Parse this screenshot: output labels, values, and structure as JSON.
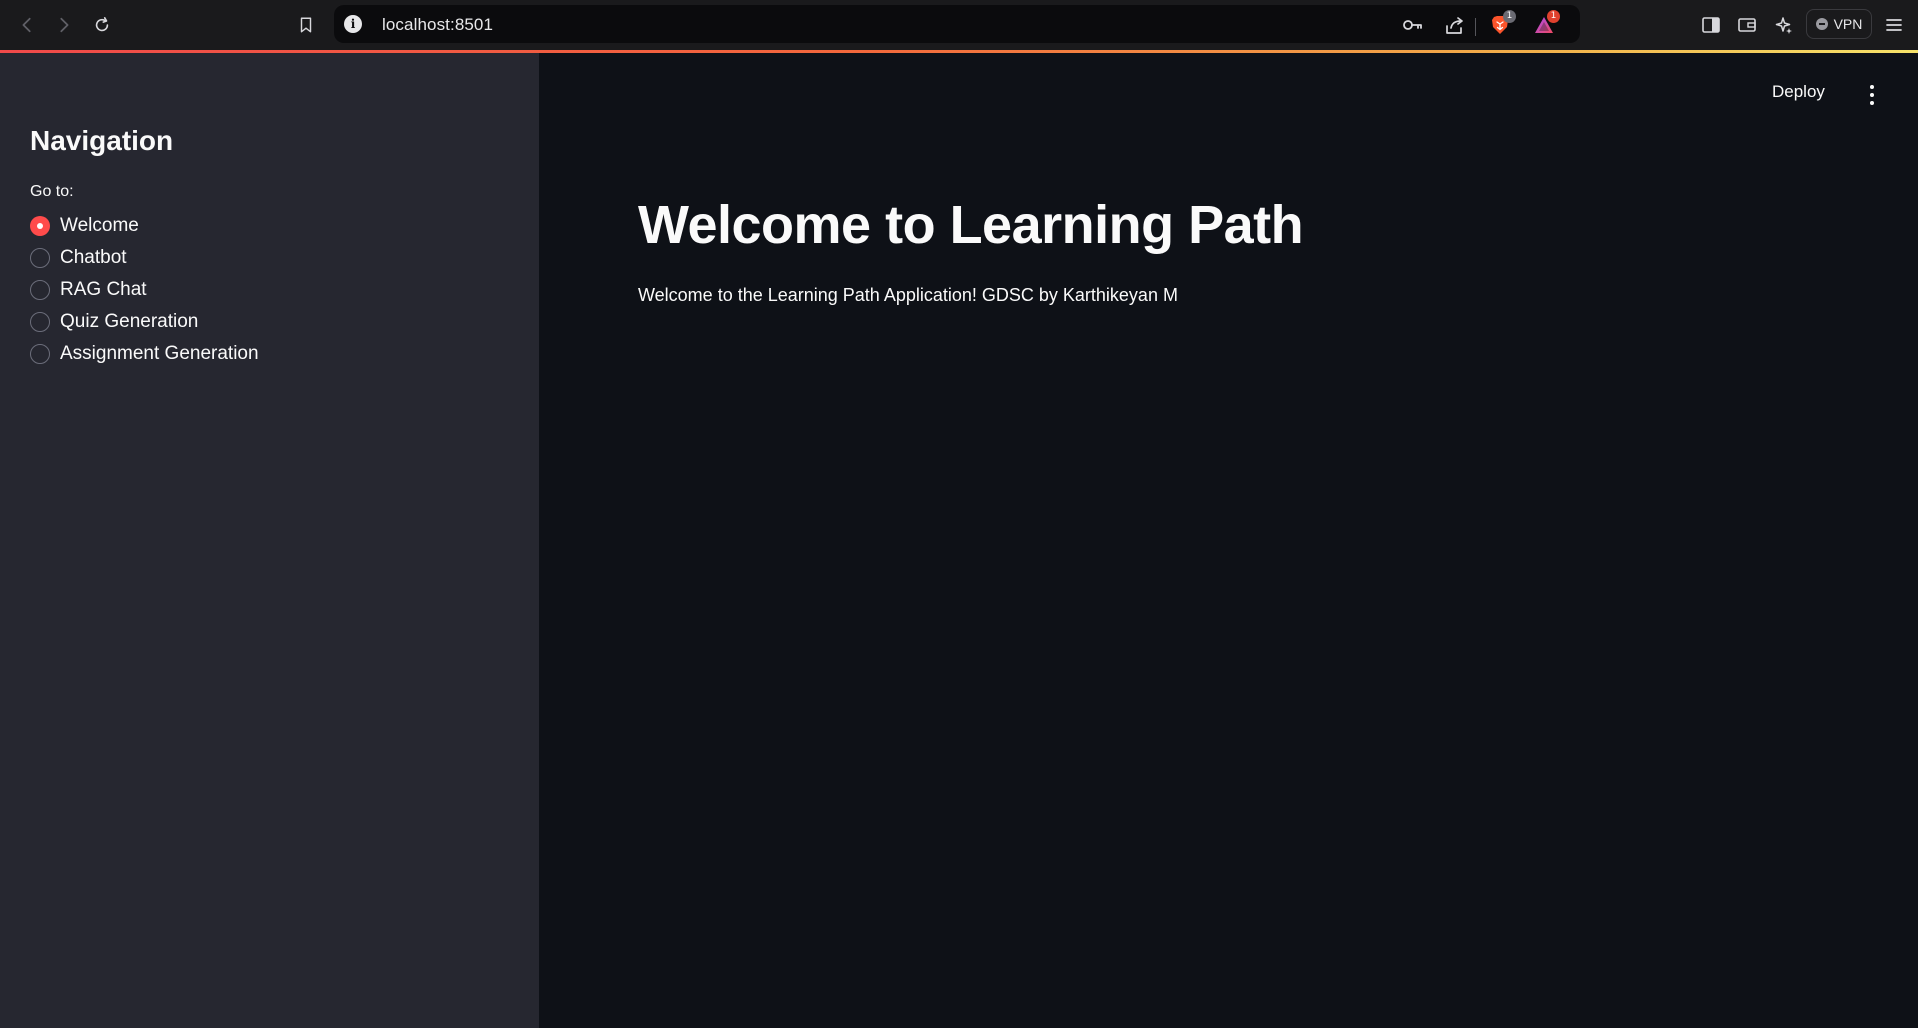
{
  "browser": {
    "url": "localhost:8501",
    "shields_badge": "1",
    "rewards_badge": "1",
    "vpn_label": "VPN"
  },
  "app": {
    "deploy_label": "Deploy",
    "sidebar": {
      "title": "Navigation",
      "radio_label": "Go to:",
      "options": [
        "Welcome",
        "Chatbot",
        "RAG Chat",
        "Quiz Generation",
        "Assignment Generation"
      ],
      "selected": "Welcome"
    },
    "main": {
      "title": "Welcome to Learning Path",
      "text": "Welcome to the Learning Path Application! GDSC by Karthikeyan M"
    }
  },
  "colors": {
    "primary": "#ff4b4b",
    "sidebar_bg": "#262730",
    "main_bg": "#0e1117",
    "text": "#fafafa"
  }
}
